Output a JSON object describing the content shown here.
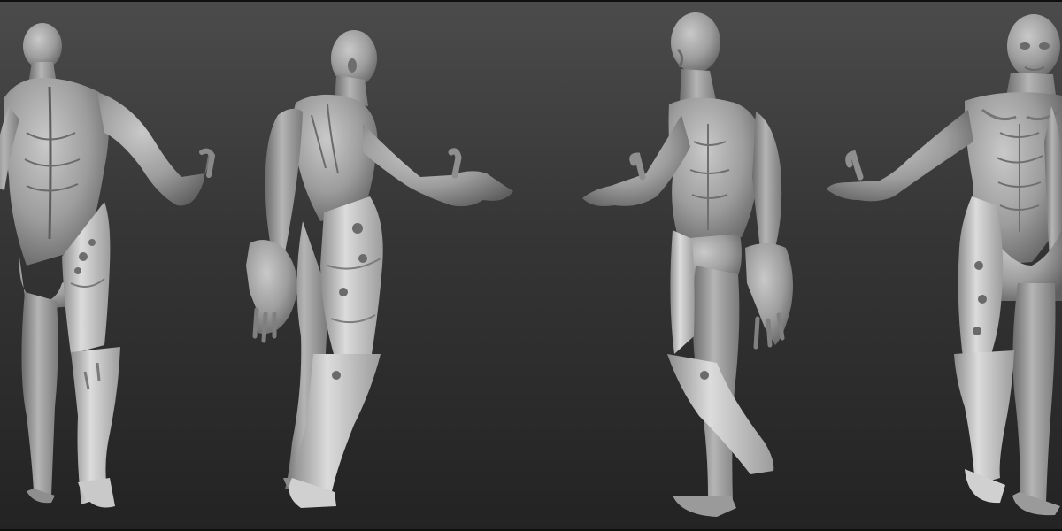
{
  "scene": {
    "background": {
      "top": "#4b4b4b",
      "middle": "#353535",
      "bottom": "#232323"
    },
    "material": {
      "skin_base": "#9a9a9a",
      "skin_light": "#c4c4c4",
      "skin_shadow": "#5f5f5f",
      "armor_light": "#d6d6d6",
      "armor_mid": "#b3b3b3",
      "armor_dark": "#7a7a7a"
    },
    "views": [
      {
        "name": "back-view",
        "label_visible": false
      },
      {
        "name": "left-side-view",
        "label_visible": false
      },
      {
        "name": "right-front-view",
        "label_visible": false
      },
      {
        "name": "front-view",
        "label_visible": false
      }
    ]
  }
}
